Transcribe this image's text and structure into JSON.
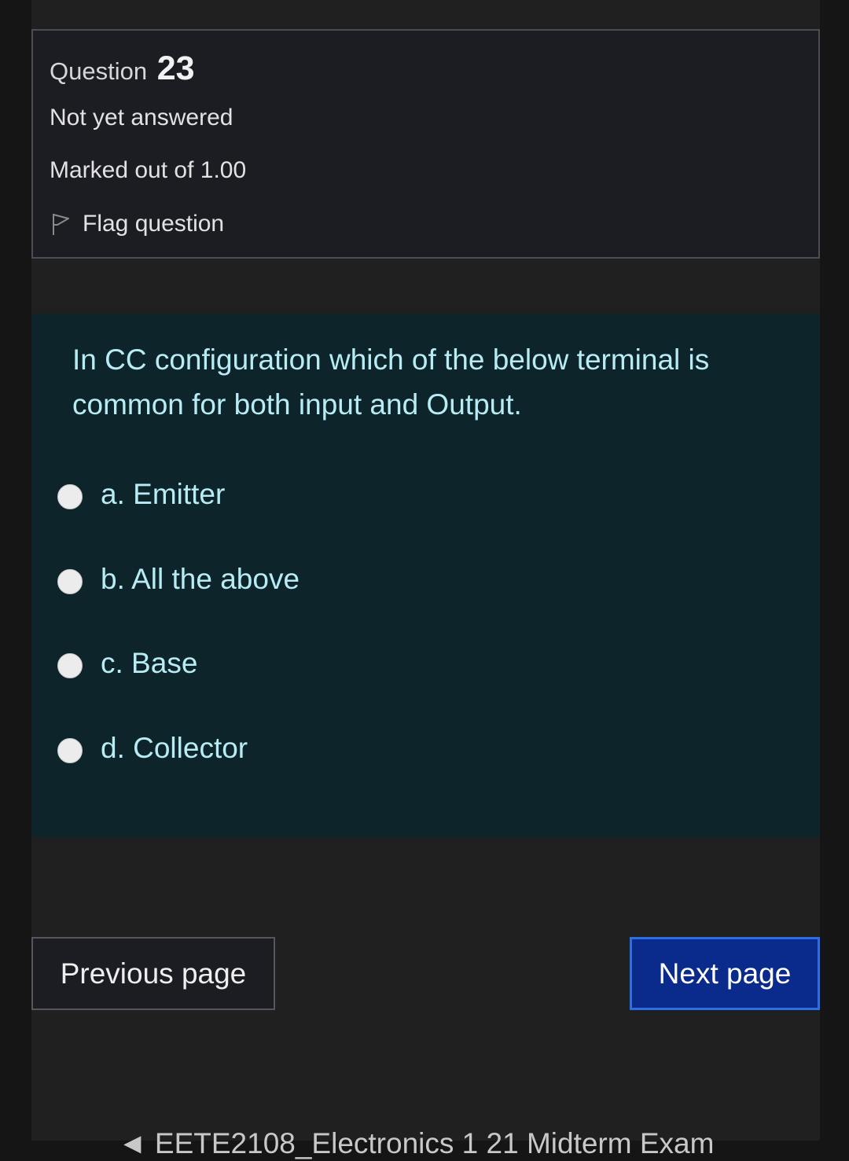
{
  "question_info": {
    "label": "Question",
    "number": "23",
    "state": "Not yet answered",
    "grade": "Marked out of 1.00",
    "flag_label": "Flag question"
  },
  "question": {
    "text": "In CC configuration which of the below terminal is common for both input and Output.",
    "options": [
      {
        "label": "a. Emitter",
        "selected": false
      },
      {
        "label": "b. All the above",
        "selected": false
      },
      {
        "label": "c. Base",
        "selected": false
      },
      {
        "label": "d. Collector",
        "selected": false
      }
    ]
  },
  "navigation": {
    "previous_label": "Previous page",
    "next_label": "Next page"
  },
  "footer": {
    "link_text": "◄ EETE2108_Electronics 1 21 Midterm Exam"
  },
  "icons": {
    "flag": "flag-outline-icon",
    "radio": "radio-unchecked-icon"
  },
  "colors": {
    "question_background": "#0c242a",
    "question_text": "#b8ecf5",
    "next_button": "#0a2a8c"
  }
}
